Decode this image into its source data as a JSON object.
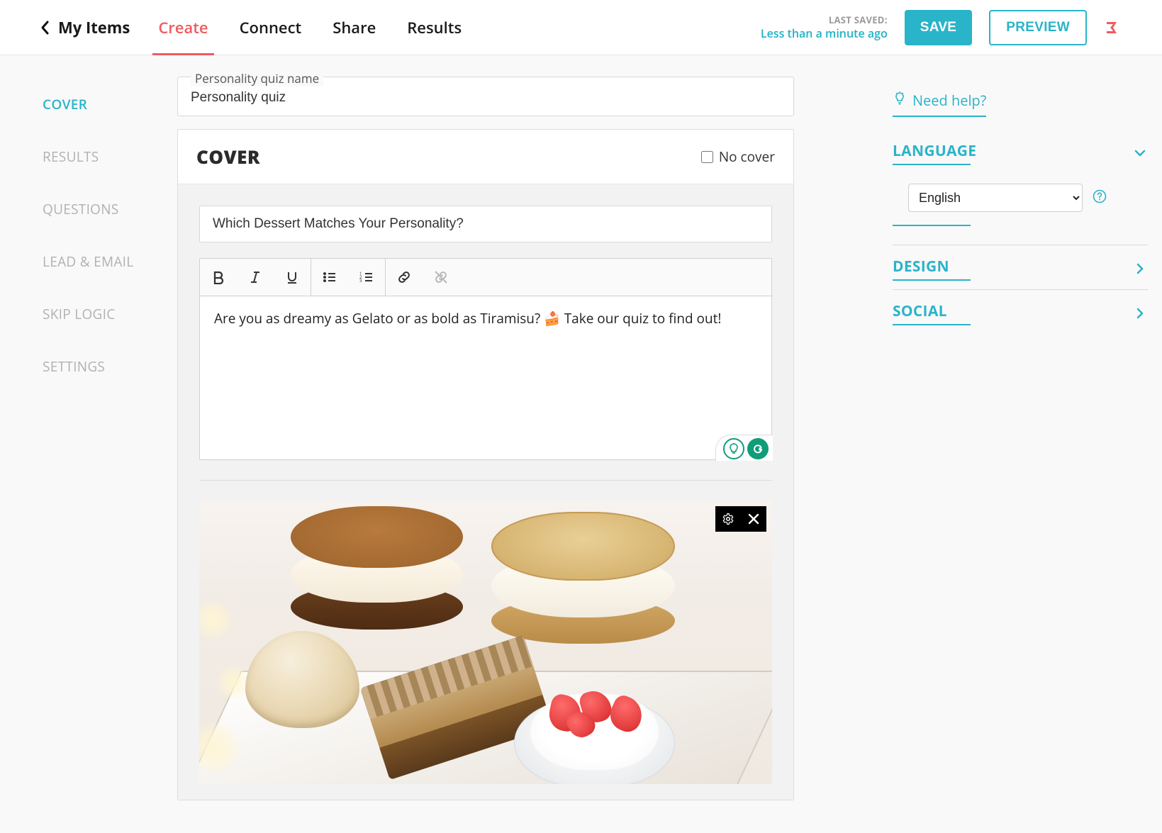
{
  "header": {
    "back_label": "My Items",
    "tabs": {
      "create": "Create",
      "connect": "Connect",
      "share": "Share",
      "results": "Results"
    },
    "last_saved_label": "LAST SAVED:",
    "last_saved_time": "Less than a minute ago",
    "save_label": "SAVE",
    "preview_label": "PREVIEW"
  },
  "left_nav": {
    "items": [
      {
        "id": "cover",
        "label": "COVER",
        "active": true
      },
      {
        "id": "results",
        "label": "RESULTS",
        "active": false
      },
      {
        "id": "questions",
        "label": "QUESTIONS",
        "active": false
      },
      {
        "id": "lead-email",
        "label": "LEAD & EMAIL",
        "active": false
      },
      {
        "id": "skip-logic",
        "label": "SKIP LOGIC",
        "active": false
      },
      {
        "id": "settings",
        "label": "SETTINGS",
        "active": false
      }
    ]
  },
  "editor": {
    "name_label": "Personality quiz name",
    "name_value": "Personality quiz",
    "cover_title": "COVER",
    "no_cover_label": "No cover",
    "no_cover_checked": false,
    "headline_value": "Which Dessert Matches Your Personality?",
    "body_text": "Are you as dreamy as Gelato or as bold as Tiramisu? 🍰 Take our quiz to find out!",
    "toolbar_icons": [
      "bold",
      "italic",
      "underline",
      "unordered-list",
      "ordered-list",
      "link",
      "unlink"
    ],
    "image_alt": "Assorted desserts on a tray"
  },
  "right": {
    "help_label": "Need help?",
    "language": {
      "title": "LANGUAGE",
      "expanded": true,
      "selected": "English",
      "options": [
        "English"
      ]
    },
    "design": {
      "title": "DESIGN",
      "expanded": false
    },
    "social": {
      "title": "SOCIAL",
      "expanded": false
    }
  }
}
